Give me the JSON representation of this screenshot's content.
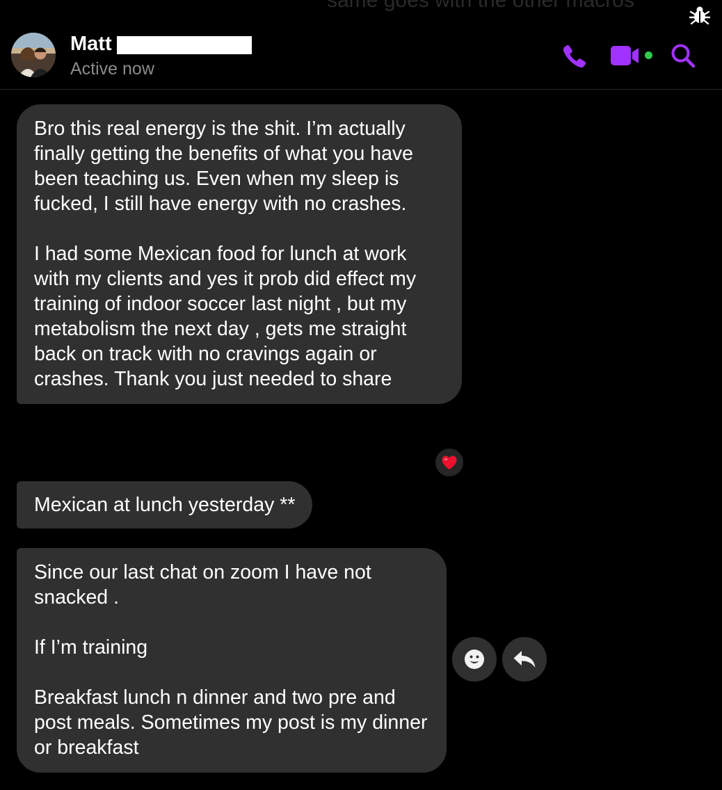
{
  "background_text": "same goes with the other macros",
  "header": {
    "contact_name": "Matt",
    "status": "Active now",
    "accent_color": "#a033ff",
    "online_color": "#31c94d",
    "icons": [
      "phone-icon",
      "video-camera-icon",
      "search-icon",
      "bug-icon"
    ]
  },
  "messages": [
    {
      "text": "Bro this real energy is the shit. I’m actually finally getting the benefits of what you have been teaching us. Even when my sleep is fucked, I still have energy with no crashes.\n\nI had some Mexican food for lunch at work with my clients and yes it prob did effect my training of indoor soccer last night , but my metabolism the next day , gets me straight back on track with no cravings again or crashes. Thank you just needed to share",
      "reaction": "red-heart"
    },
    {
      "text": "Mexican at lunch yesterday **"
    },
    {
      "text": "Since our last chat on zoom I have not snacked .\n\nIf I’m training\n\nBreakfast lunch n dinner and two pre and post meals. Sometimes my post is my dinner or breakfast"
    }
  ],
  "hover_actions": [
    "smiley-icon",
    "reply-icon"
  ]
}
